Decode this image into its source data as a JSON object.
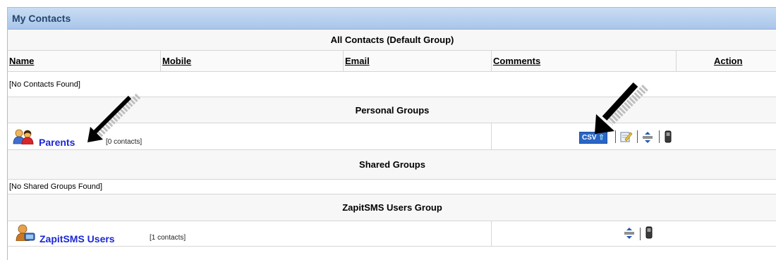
{
  "panel": {
    "title": "My Contacts"
  },
  "sections": {
    "all_contacts": "All Contacts (Default Group)",
    "personal_groups": "Personal Groups",
    "shared_groups": "Shared Groups",
    "users_group": "ZapitSMS Users Group"
  },
  "columns": {
    "name": "Name",
    "mobile": "Mobile",
    "email": "Email",
    "comments": "Comments",
    "action": "Action"
  },
  "empty": {
    "contacts": "[No Contacts Found]",
    "shared": "[No Shared Groups Found]"
  },
  "groups": [
    {
      "name": "Parents",
      "count": "[0 contacts]",
      "icon": "people-group-icon"
    },
    {
      "name": "ZapitSMS Users",
      "count": "[1 contacts]",
      "icon": "user-group-icon"
    }
  ],
  "actions": {
    "csv_label": "CSV",
    "icons": [
      "csv-upload-icon",
      "edit-icon",
      "expand-collapse-icon",
      "mobile-phone-icon"
    ]
  },
  "colors": {
    "header_bg": "#b4cfee",
    "link": "#1b27d6",
    "csv_bg": "#2a66c4"
  }
}
